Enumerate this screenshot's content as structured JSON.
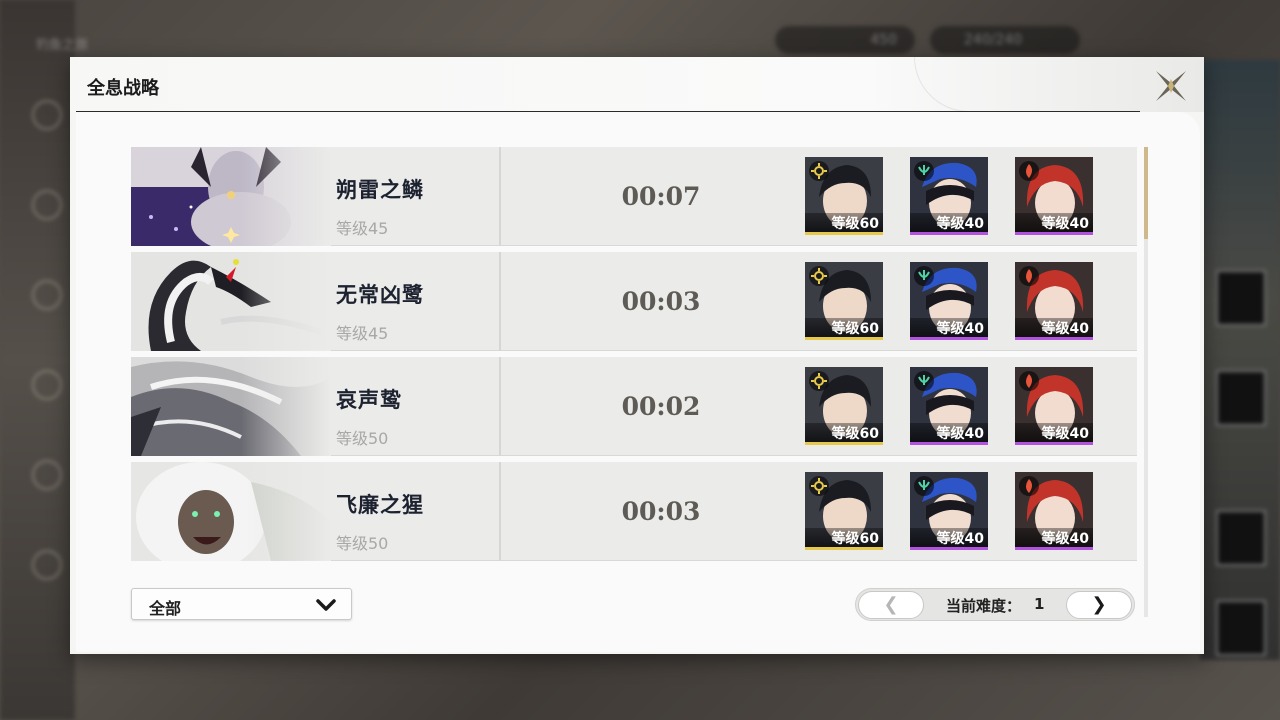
{
  "background_hud": {
    "back_label": "钓鱼之旅",
    "currency_1": "450",
    "stamina": "240/240"
  },
  "dialog": {
    "title": "全息战略"
  },
  "bosses": [
    {
      "name": "朔雷之鳞",
      "level": "等级45",
      "clear_time": "00:07",
      "team": [
        {
          "level": "等级60",
          "element": "spectro",
          "rarity": "gold"
        },
        {
          "level": "等级40",
          "element": "aero",
          "rarity": "purple"
        },
        {
          "level": "等级40",
          "element": "fusion",
          "rarity": "purple"
        }
      ]
    },
    {
      "name": "无常凶鹭",
      "level": "等级45",
      "clear_time": "00:03",
      "team": [
        {
          "level": "等级60",
          "element": "spectro",
          "rarity": "gold"
        },
        {
          "level": "等级40",
          "element": "aero",
          "rarity": "purple"
        },
        {
          "level": "等级40",
          "element": "fusion",
          "rarity": "purple"
        }
      ]
    },
    {
      "name": "哀声鸷",
      "level": "等级50",
      "clear_time": "00:02",
      "team": [
        {
          "level": "等级60",
          "element": "spectro",
          "rarity": "gold"
        },
        {
          "level": "等级40",
          "element": "aero",
          "rarity": "purple"
        },
        {
          "level": "等级40",
          "element": "fusion",
          "rarity": "purple"
        }
      ]
    },
    {
      "name": "飞廉之猩",
      "level": "等级50",
      "clear_time": "00:03",
      "team": [
        {
          "level": "等级60",
          "element": "spectro",
          "rarity": "gold"
        },
        {
          "level": "等级40",
          "element": "aero",
          "rarity": "purple"
        },
        {
          "level": "等级40",
          "element": "fusion",
          "rarity": "purple"
        }
      ]
    }
  ],
  "filter": {
    "selected": "全部"
  },
  "pager": {
    "prev_symbol": "❮",
    "next_symbol": "❯",
    "label": "当前难度：",
    "value": "1"
  },
  "colors": {
    "gold_rarity": "#e6c84a",
    "purple_rarity": "#b253e0",
    "spectro": "#e8c94a",
    "aero": "#4fd2a8",
    "fusion": "#e8553a"
  }
}
